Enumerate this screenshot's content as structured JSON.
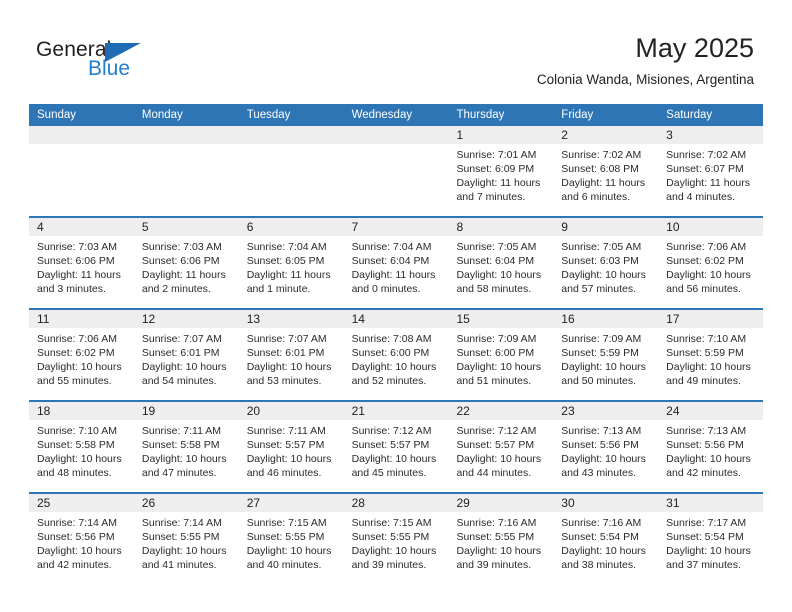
{
  "brand": {
    "logo_word_1": "General",
    "logo_word_2": "Blue",
    "triangle_icon": "triangle-icon",
    "accent_color": "#2e75b6",
    "logo_blue": "#1f7fd0"
  },
  "header": {
    "title": "May 2025",
    "subtitle": "Colonia Wanda, Misiones, Argentina"
  },
  "calendar": {
    "weekdays": [
      "Sunday",
      "Monday",
      "Tuesday",
      "Wednesday",
      "Thursday",
      "Friday",
      "Saturday"
    ],
    "weeks": [
      [
        {
          "day": "",
          "sunrise": "",
          "sunset": "",
          "daylight": ""
        },
        {
          "day": "",
          "sunrise": "",
          "sunset": "",
          "daylight": ""
        },
        {
          "day": "",
          "sunrise": "",
          "sunset": "",
          "daylight": ""
        },
        {
          "day": "",
          "sunrise": "",
          "sunset": "",
          "daylight": ""
        },
        {
          "day": "1",
          "sunrise": "Sunrise: 7:01 AM",
          "sunset": "Sunset: 6:09 PM",
          "daylight": "Daylight: 11 hours and 7 minutes."
        },
        {
          "day": "2",
          "sunrise": "Sunrise: 7:02 AM",
          "sunset": "Sunset: 6:08 PM",
          "daylight": "Daylight: 11 hours and 6 minutes."
        },
        {
          "day": "3",
          "sunrise": "Sunrise: 7:02 AM",
          "sunset": "Sunset: 6:07 PM",
          "daylight": "Daylight: 11 hours and 4 minutes."
        }
      ],
      [
        {
          "day": "4",
          "sunrise": "Sunrise: 7:03 AM",
          "sunset": "Sunset: 6:06 PM",
          "daylight": "Daylight: 11 hours and 3 minutes."
        },
        {
          "day": "5",
          "sunrise": "Sunrise: 7:03 AM",
          "sunset": "Sunset: 6:06 PM",
          "daylight": "Daylight: 11 hours and 2 minutes."
        },
        {
          "day": "6",
          "sunrise": "Sunrise: 7:04 AM",
          "sunset": "Sunset: 6:05 PM",
          "daylight": "Daylight: 11 hours and 1 minute."
        },
        {
          "day": "7",
          "sunrise": "Sunrise: 7:04 AM",
          "sunset": "Sunset: 6:04 PM",
          "daylight": "Daylight: 11 hours and 0 minutes."
        },
        {
          "day": "8",
          "sunrise": "Sunrise: 7:05 AM",
          "sunset": "Sunset: 6:04 PM",
          "daylight": "Daylight: 10 hours and 58 minutes."
        },
        {
          "day": "9",
          "sunrise": "Sunrise: 7:05 AM",
          "sunset": "Sunset: 6:03 PM",
          "daylight": "Daylight: 10 hours and 57 minutes."
        },
        {
          "day": "10",
          "sunrise": "Sunrise: 7:06 AM",
          "sunset": "Sunset: 6:02 PM",
          "daylight": "Daylight: 10 hours and 56 minutes."
        }
      ],
      [
        {
          "day": "11",
          "sunrise": "Sunrise: 7:06 AM",
          "sunset": "Sunset: 6:02 PM",
          "daylight": "Daylight: 10 hours and 55 minutes."
        },
        {
          "day": "12",
          "sunrise": "Sunrise: 7:07 AM",
          "sunset": "Sunset: 6:01 PM",
          "daylight": "Daylight: 10 hours and 54 minutes."
        },
        {
          "day": "13",
          "sunrise": "Sunrise: 7:07 AM",
          "sunset": "Sunset: 6:01 PM",
          "daylight": "Daylight: 10 hours and 53 minutes."
        },
        {
          "day": "14",
          "sunrise": "Sunrise: 7:08 AM",
          "sunset": "Sunset: 6:00 PM",
          "daylight": "Daylight: 10 hours and 52 minutes."
        },
        {
          "day": "15",
          "sunrise": "Sunrise: 7:09 AM",
          "sunset": "Sunset: 6:00 PM",
          "daylight": "Daylight: 10 hours and 51 minutes."
        },
        {
          "day": "16",
          "sunrise": "Sunrise: 7:09 AM",
          "sunset": "Sunset: 5:59 PM",
          "daylight": "Daylight: 10 hours and 50 minutes."
        },
        {
          "day": "17",
          "sunrise": "Sunrise: 7:10 AM",
          "sunset": "Sunset: 5:59 PM",
          "daylight": "Daylight: 10 hours and 49 minutes."
        }
      ],
      [
        {
          "day": "18",
          "sunrise": "Sunrise: 7:10 AM",
          "sunset": "Sunset: 5:58 PM",
          "daylight": "Daylight: 10 hours and 48 minutes."
        },
        {
          "day": "19",
          "sunrise": "Sunrise: 7:11 AM",
          "sunset": "Sunset: 5:58 PM",
          "daylight": "Daylight: 10 hours and 47 minutes."
        },
        {
          "day": "20",
          "sunrise": "Sunrise: 7:11 AM",
          "sunset": "Sunset: 5:57 PM",
          "daylight": "Daylight: 10 hours and 46 minutes."
        },
        {
          "day": "21",
          "sunrise": "Sunrise: 7:12 AM",
          "sunset": "Sunset: 5:57 PM",
          "daylight": "Daylight: 10 hours and 45 minutes."
        },
        {
          "day": "22",
          "sunrise": "Sunrise: 7:12 AM",
          "sunset": "Sunset: 5:57 PM",
          "daylight": "Daylight: 10 hours and 44 minutes."
        },
        {
          "day": "23",
          "sunrise": "Sunrise: 7:13 AM",
          "sunset": "Sunset: 5:56 PM",
          "daylight": "Daylight: 10 hours and 43 minutes."
        },
        {
          "day": "24",
          "sunrise": "Sunrise: 7:13 AM",
          "sunset": "Sunset: 5:56 PM",
          "daylight": "Daylight: 10 hours and 42 minutes."
        }
      ],
      [
        {
          "day": "25",
          "sunrise": "Sunrise: 7:14 AM",
          "sunset": "Sunset: 5:56 PM",
          "daylight": "Daylight: 10 hours and 42 minutes."
        },
        {
          "day": "26",
          "sunrise": "Sunrise: 7:14 AM",
          "sunset": "Sunset: 5:55 PM",
          "daylight": "Daylight: 10 hours and 41 minutes."
        },
        {
          "day": "27",
          "sunrise": "Sunrise: 7:15 AM",
          "sunset": "Sunset: 5:55 PM",
          "daylight": "Daylight: 10 hours and 40 minutes."
        },
        {
          "day": "28",
          "sunrise": "Sunrise: 7:15 AM",
          "sunset": "Sunset: 5:55 PM",
          "daylight": "Daylight: 10 hours and 39 minutes."
        },
        {
          "day": "29",
          "sunrise": "Sunrise: 7:16 AM",
          "sunset": "Sunset: 5:55 PM",
          "daylight": "Daylight: 10 hours and 39 minutes."
        },
        {
          "day": "30",
          "sunrise": "Sunrise: 7:16 AM",
          "sunset": "Sunset: 5:54 PM",
          "daylight": "Daylight: 10 hours and 38 minutes."
        },
        {
          "day": "31",
          "sunrise": "Sunrise: 7:17 AM",
          "sunset": "Sunset: 5:54 PM",
          "daylight": "Daylight: 10 hours and 37 minutes."
        }
      ]
    ]
  }
}
